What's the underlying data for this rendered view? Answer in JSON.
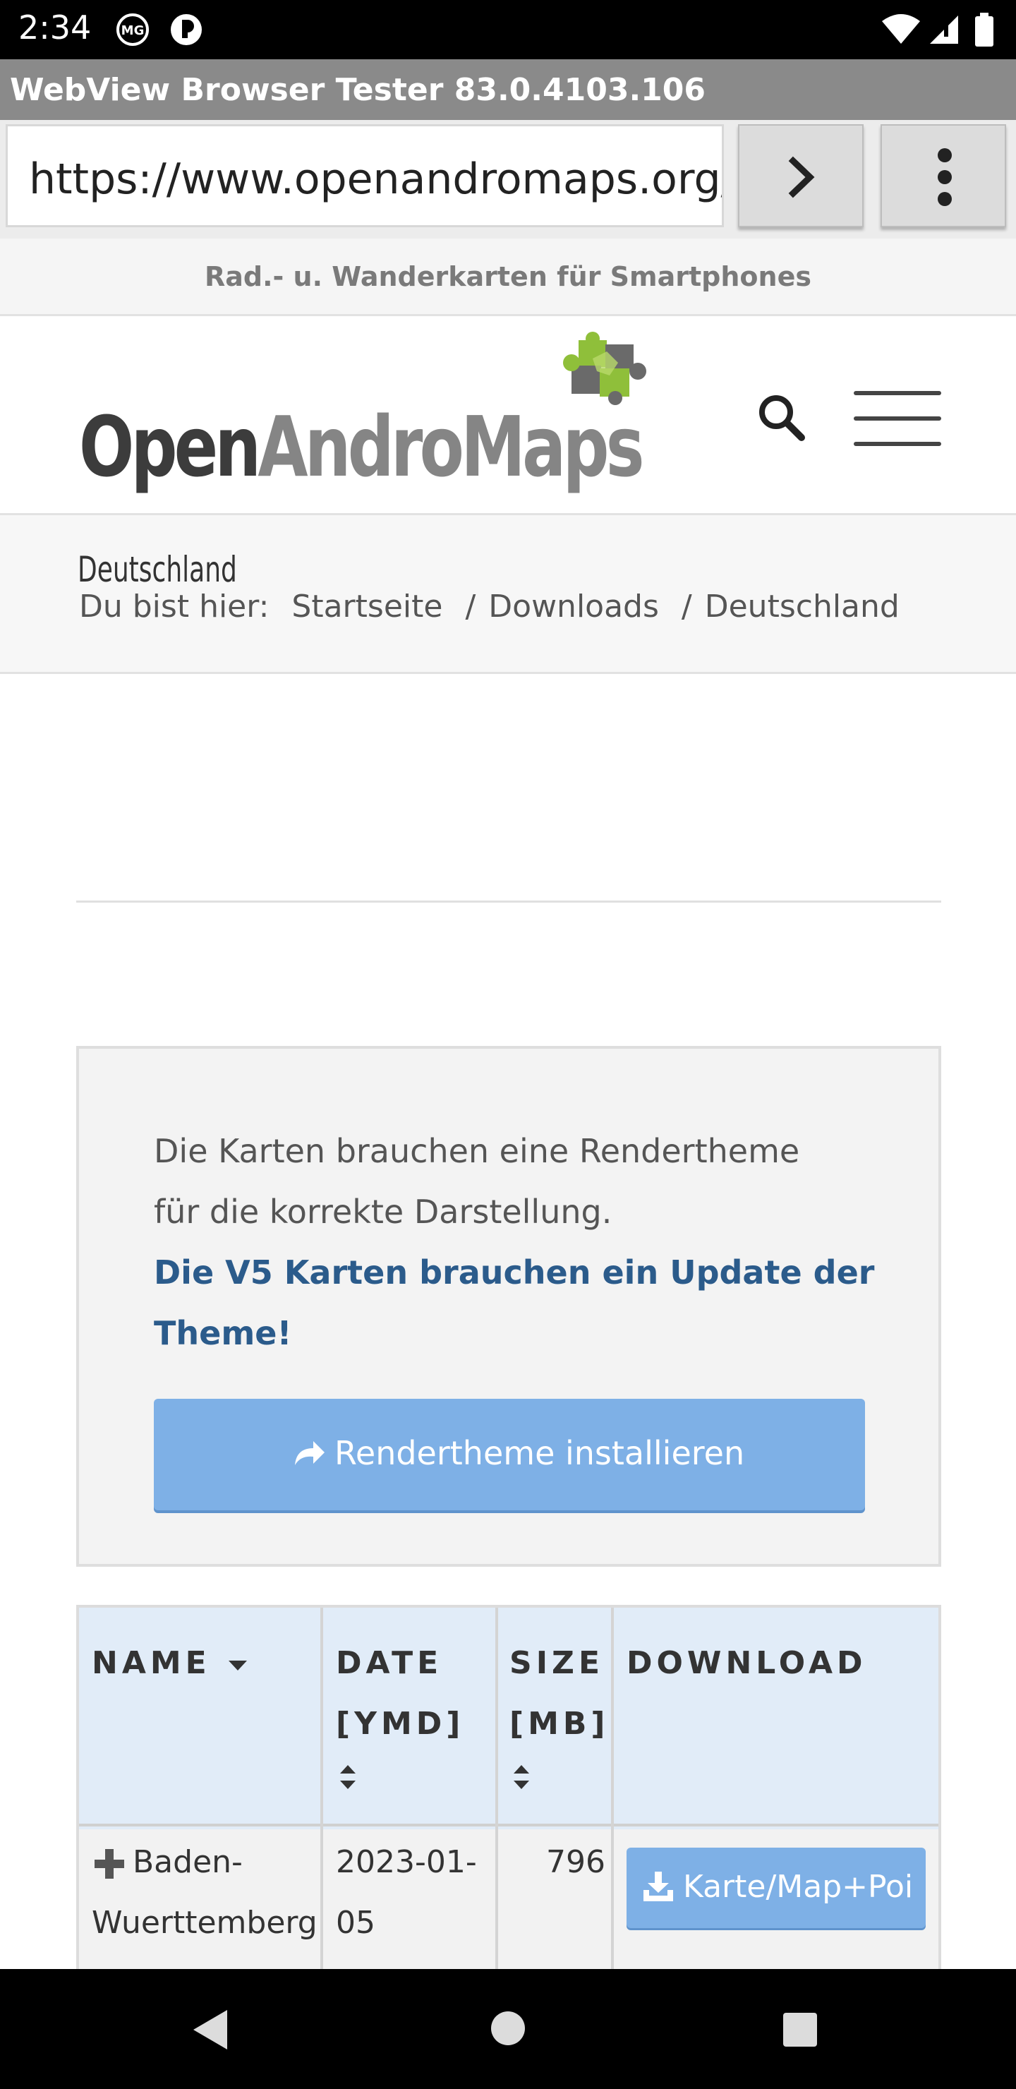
{
  "status_bar": {
    "time": "2:34"
  },
  "tester": {
    "title": "WebView Browser Tester 83.0.4103.106"
  },
  "url_bar": {
    "value": "https://www.openandromaps.org/de/downloads/deutschland"
  },
  "site": {
    "tagline": "Rad.- u. Wanderkarten für Smartphones",
    "logo": {
      "part1": "Open",
      "part2": "AndroMaps"
    },
    "page_title": "Deutschland",
    "breadcrumb": {
      "prefix": "Du bist hier:",
      "items": [
        "Startseite",
        "Downloads",
        "Deutschland"
      ],
      "separator": "/"
    }
  },
  "info_box": {
    "line1": "Die Karten brauchen eine Rendertheme",
    "line2": "für die korrekte Darstellung.",
    "bold_line1": "Die V5 Karten brauchen ein Update der",
    "bold_line2": "Theme!",
    "button_label": "Rendertheme installieren"
  },
  "table": {
    "headers": {
      "name": "NAME",
      "date_1": "DATE",
      "date_2": "[YMD]",
      "size_1": "SIZE",
      "size_2": "[MB]",
      "download": "DOWNLOAD"
    },
    "rows": [
      {
        "name_1": "Baden-",
        "name_2": "Wuerttemberg",
        "date_1": "2023-01-",
        "date_2": "05",
        "size": "796",
        "download_label": "Karte/Map+Poi"
      }
    ]
  },
  "colors": {
    "accent_button": "#7eb0e6",
    "bold_text": "#2b5b8b",
    "table_header_bg": "#e1ecf8"
  }
}
